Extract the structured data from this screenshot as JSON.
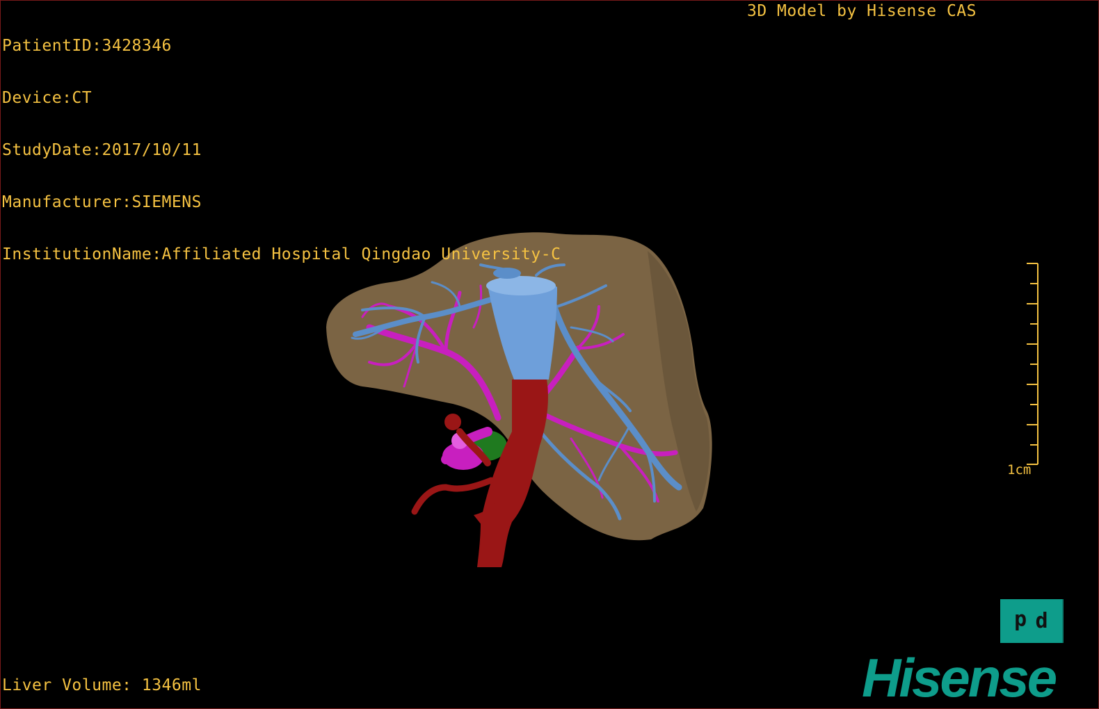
{
  "info": {
    "patient": "PatientID:3428346",
    "device": "Device:CT",
    "study_date": "StudyDate:2017/10/11",
    "manufacturer": "Manufacturer:SIEMENS",
    "institution": "InstitutionName:Affiliated Hospital Qingdao University-C"
  },
  "credit": "3D Model by Hisense CAS",
  "volume": "Liver Volume: 1346ml",
  "scale": {
    "label": "1cm",
    "ticks": 10
  },
  "orientation": {
    "left_glyph": "d",
    "right_glyph": "d"
  },
  "logo": {
    "text": "Hisense",
    "color": "#0e9d8b"
  },
  "colors": {
    "text": "#f5c242",
    "liver": "#7b6444",
    "hepatic_vein": "#5b8ec9",
    "portal_vein": "#c81fbf",
    "artery": "#9a1616",
    "gallbladder_green": "#1f7a1f"
  }
}
